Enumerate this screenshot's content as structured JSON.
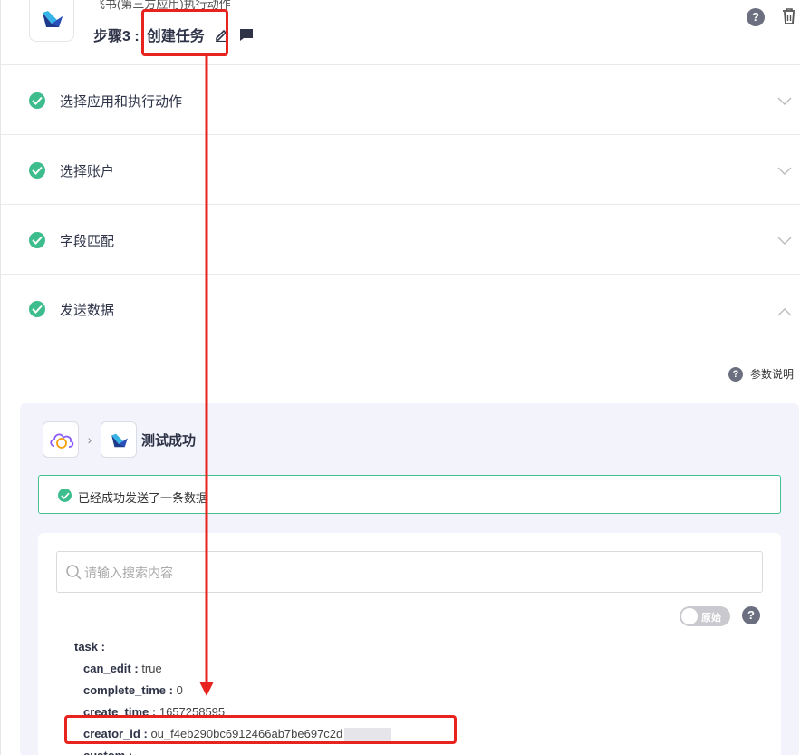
{
  "header": {
    "app_subtitle": "飞书(第三方应用)执行动作",
    "step_prefix": "步骤3 :",
    "step_name": "创建任务",
    "icons": [
      "feishu-logo",
      "edit-icon",
      "comment-icon",
      "help-icon",
      "trash-icon"
    ]
  },
  "sections": [
    {
      "label": "选择应用和执行动作",
      "status": "done",
      "expanded": false
    },
    {
      "label": "选择账户",
      "status": "done",
      "expanded": false
    },
    {
      "label": "字段匹配",
      "status": "done",
      "expanded": false
    },
    {
      "label": "发送数据",
      "status": "done",
      "expanded": true
    }
  ],
  "param_help": {
    "label": "参数说明"
  },
  "test_panel": {
    "flow_result": "测试成功",
    "success_message": "已经成功发送了一条数据",
    "search": {
      "placeholder": "请输入搜索内容",
      "value": ""
    },
    "raw_toggle": {
      "label": "原始",
      "on": false
    },
    "tree": {
      "root_key": "task :",
      "fields": [
        {
          "key": "can_edit :",
          "value": "true"
        },
        {
          "key": "complete_time :",
          "value": "0"
        },
        {
          "key": "create_time :",
          "value": "1657258595"
        },
        {
          "key": "creator_id :",
          "value": "ou_f4eb290bc6912466ab7be697c2d"
        },
        {
          "key": "custom :",
          "value": ""
        }
      ]
    }
  },
  "colors": {
    "success": "#3dbd8d",
    "annotation": "#e8231e",
    "panel_bg": "#f3f3fb",
    "title": "#2e3347"
  }
}
